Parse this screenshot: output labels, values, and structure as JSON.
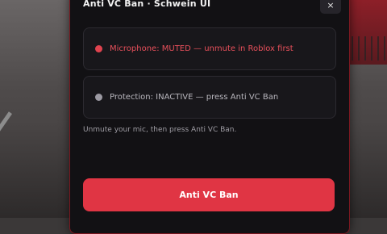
{
  "panel": {
    "title": "Anti VC Ban · Schwein UI",
    "close_icon": "×",
    "microphone_status": "Microphone: MUTED — unmute in Roblox first",
    "protection_status": "Protection: INACTIVE — press Anti VC Ban",
    "hint": "Unmute your mic, then press Anti VC Ban.",
    "action_label": "Anti VC Ban"
  },
  "colors": {
    "accent": "#e03544",
    "muted_status": "#e8505b",
    "inactive_status": "#9c9aa3",
    "panel_bg": "#121114"
  },
  "icons": {
    "close": "close-icon",
    "microphone_indicator": "status-dot-icon",
    "protection_indicator": "status-dot-icon"
  }
}
